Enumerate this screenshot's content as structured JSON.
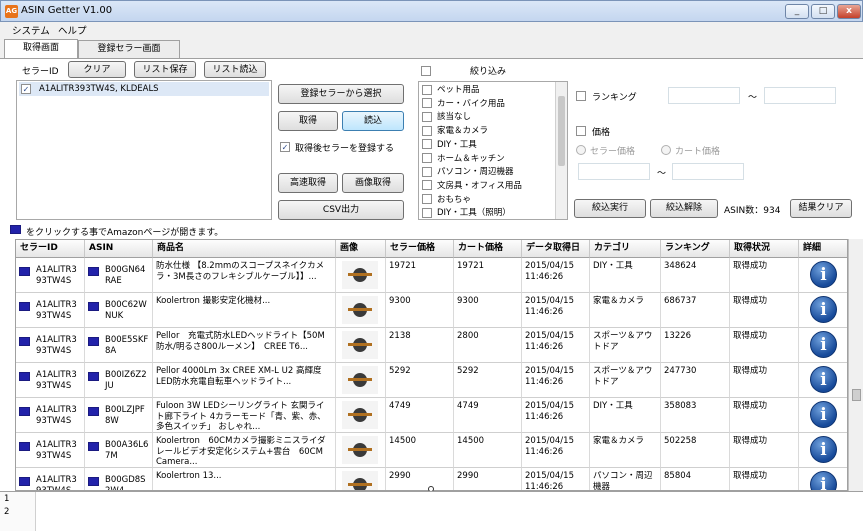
{
  "window": {
    "icon_text": "AG",
    "title": "ASIN Getter V1.00",
    "controls": [
      "_",
      "□",
      "x"
    ]
  },
  "menu": [
    "システム",
    "ヘルプ"
  ],
  "tabs": [
    {
      "label": "取得画面",
      "active": true
    },
    {
      "label": "登録セラー画面",
      "active": false
    }
  ],
  "seller": {
    "label": "セラーID",
    "clear_btn": "クリア",
    "save_btn": "リスト保存",
    "load_btn": "リスト読込",
    "list": [
      {
        "text": "A1ALITR393TW4S, KLDEALS",
        "checked": true
      }
    ]
  },
  "actions": {
    "select_registered": "登録セラーから選択",
    "fetch": "取得",
    "read": "読込",
    "register_after": "取得後セラーを登録する",
    "register_after_checked": true,
    "fast_fetch": "高速取得",
    "image_fetch": "画像取得",
    "csv": "CSV出力"
  },
  "filter": {
    "title": "絞り込み",
    "categories": [
      "ペット用品",
      "カー・バイク用品",
      "該当なし",
      "家電＆カメラ",
      "DIY・工具",
      "ホーム＆キッチン",
      "パソコン・周辺機器",
      "文房具・オフィス用品",
      "おもちゃ",
      "DIY・工具（照明）"
    ],
    "ranking_label": "ランキング",
    "tilde": "～",
    "price_label": "価格",
    "seller_price": "セラー価格",
    "cart_price": "カート価格",
    "apply_btn": "絞込実行",
    "reset_btn": "絞込解除",
    "asin_count": "ASIN数：934",
    "clear_results": "結果クリア"
  },
  "hint": "をクリックする事でAmazonページが開きます。",
  "table": {
    "headers": [
      "セラーID",
      "ASIN",
      "商品名",
      "画像",
      "セラー価格",
      "カート価格",
      "データ取得日",
      "カテゴリ",
      "ランキング",
      "取得状況",
      "詳細"
    ],
    "rows": [
      {
        "seller": "A1ALITR393TW4S",
        "asin": "B00GN64RAE",
        "name": "防水仕様 【8.2mmのスコープスネイクカメラ・3M長さのフレキシブルケーブル】】...",
        "seller_price": "19721",
        "cart_price": "19721",
        "date": "2015/04/15 11:46:26",
        "category": "DIY・工具",
        "rank": "348624",
        "status": "取得成功"
      },
      {
        "seller": "A1ALITR393TW4S",
        "asin": "B00C62WNUK",
        "name": "Koolertron 撮影安定化機材...",
        "seller_price": "9300",
        "cart_price": "9300",
        "date": "2015/04/15 11:46:26",
        "category": "家電＆カメラ",
        "rank": "686737",
        "status": "取得成功"
      },
      {
        "seller": "A1ALITR393TW4S",
        "asin": "B00E5SKF8A",
        "name": "Pellor　充電式防水LEDヘッドライト【50M防水/明るさ800ルーメン】　CREE T6...",
        "seller_price": "2138",
        "cart_price": "2800",
        "date": "2015/04/15 11:46:26",
        "category": "スポーツ＆アウトドア",
        "rank": "13226",
        "status": "取得成功"
      },
      {
        "seller": "A1ALITR393TW4S",
        "asin": "B00IZ6Z2JU",
        "name": "Pellor 4000Lm 3x CREE XM-L U2 高輝度LED防水充電自転車ヘッドライト...",
        "seller_price": "5292",
        "cart_price": "5292",
        "date": "2015/04/15 11:46:26",
        "category": "スポーツ＆アウトドア",
        "rank": "247730",
        "status": "取得成功"
      },
      {
        "seller": "A1ALITR393TW4S",
        "asin": "B00LZJPF8W",
        "name": "Fuloon 3W LEDシーリングライト 玄関ライト廊下ライト 4カラーモード「青、紫、赤、多色スイッチ」 おしゃれ...",
        "seller_price": "4749",
        "cart_price": "4749",
        "date": "2015/04/15 11:46:26",
        "category": "DIY・工具",
        "rank": "358083",
        "status": "取得成功"
      },
      {
        "seller": "A1ALITR393TW4S",
        "asin": "B00A36L67M",
        "name": "Koolertron　60CMカメラ撮影ミニスライダレールビデオ安定化システム+雲台　60CM Camera...",
        "seller_price": "14500",
        "cart_price": "14500",
        "date": "2015/04/15 11:46:26",
        "category": "家電＆カメラ",
        "rank": "502258",
        "status": "取得成功"
      },
      {
        "seller": "A1ALITR393TW4S",
        "asin": "B00GD8S2W4",
        "name": "Koolertron 13...",
        "seller_price": "2990",
        "cart_price": "2990",
        "date": "2015/04/15 11:46:26",
        "category": "パソコン・周辺機器",
        "rank": "85804",
        "status": "取得成功"
      }
    ]
  },
  "log_lines": [
    "1",
    "2"
  ]
}
